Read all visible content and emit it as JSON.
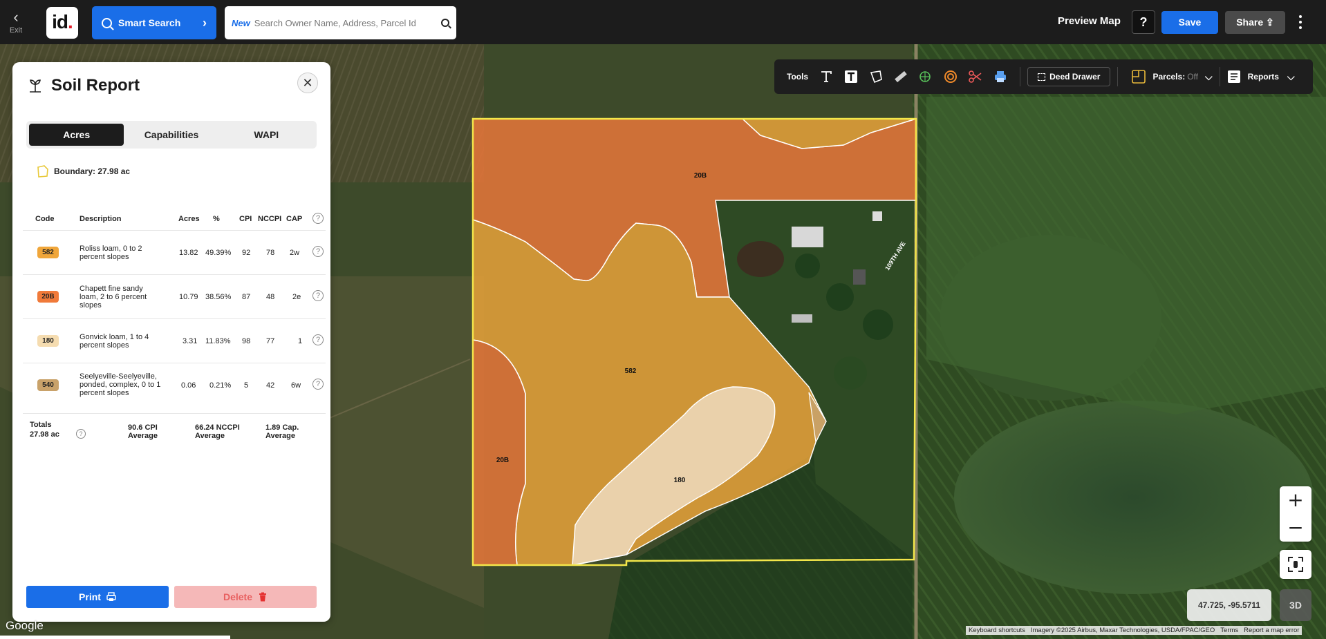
{
  "topbar": {
    "exit_label": "Exit",
    "logo_text": "id",
    "logo_dot": ".",
    "smart_search_label": "Smart Search",
    "search_new_tag": "New",
    "search_placeholder": "Search Owner Name, Address, Parcel Id",
    "preview_map_label": "Preview Map",
    "help_label": "?",
    "save_label": "Save",
    "share_label": "Share"
  },
  "toolsbar": {
    "tools_label": "Tools",
    "deed_drawer_label": "Deed Drawer",
    "parcels_label": "Parcels:",
    "parcels_state": "Off",
    "reports_label": "Reports"
  },
  "panel": {
    "title": "Soil Report",
    "tabs": [
      {
        "label": "Acres",
        "active": true
      },
      {
        "label": "Capabilities",
        "active": false
      },
      {
        "label": "WAPI",
        "active": false
      }
    ],
    "boundary": "Boundary: 27.98 ac",
    "table": {
      "headers": {
        "code": "Code",
        "description": "Description",
        "acres": "Acres",
        "pct": "%",
        "cpi": "CPI",
        "nccpi": "NCCPI",
        "cap": "CAP"
      },
      "rows": [
        {
          "code": "582",
          "color": "#f0a63a",
          "description": "Roliss loam, 0 to 2 percent slopes",
          "acres": "13.82",
          "pct": "49.39%",
          "cpi": "92",
          "nccpi": "78",
          "cap": "2w"
        },
        {
          "code": "20B",
          "color": "#f07a3a",
          "description": "Chapett fine sandy loam, 2 to 6 percent slopes",
          "acres": "10.79",
          "pct": "38.56%",
          "cpi": "87",
          "nccpi": "48",
          "cap": "2e"
        },
        {
          "code": "180",
          "color": "#f5dcb0",
          "description": "Gonvick loam, 1 to 4 percent slopes",
          "acres": "3.31",
          "pct": "11.83%",
          "cpi": "98",
          "nccpi": "77",
          "cap": "1"
        },
        {
          "code": "540",
          "color": "#c9a26a",
          "description": "Seelyeville-Seelyeville, ponded, complex, 0 to 1 percent slopes",
          "acres": "0.06",
          "pct": "0.21%",
          "cpi": "5",
          "nccpi": "42",
          "cap": "6w"
        }
      ],
      "totals": {
        "label": "Totals",
        "acres": "27.98 ac",
        "cpi": "90.6 CPI",
        "cpi_sub": "Average",
        "nccpi": "66.24 NCCPI",
        "nccpi_sub": "Average",
        "cap": "1.89 Cap.",
        "cap_sub": "Average"
      }
    },
    "print_label": "Print",
    "delete_label": "Delete"
  },
  "map": {
    "polygon_labels": {
      "a": "20B",
      "b": "582",
      "c": "20B",
      "d": "180"
    },
    "road_label": "109TH AVE",
    "coords": "47.725, -95.5711",
    "mode_3d": "3D",
    "google": "Google",
    "attribution": [
      "Keyboard shortcuts",
      "Imagery ©2025 Airbus, Maxar Technologies, USDA/FPAC/GEO",
      "Terms",
      "Report a map error"
    ],
    "colors": {
      "soil_582": "#e8a23a",
      "soil_20b": "#e7773a",
      "soil_180": "#eedcc0",
      "boundary": "#f3e64a"
    }
  }
}
